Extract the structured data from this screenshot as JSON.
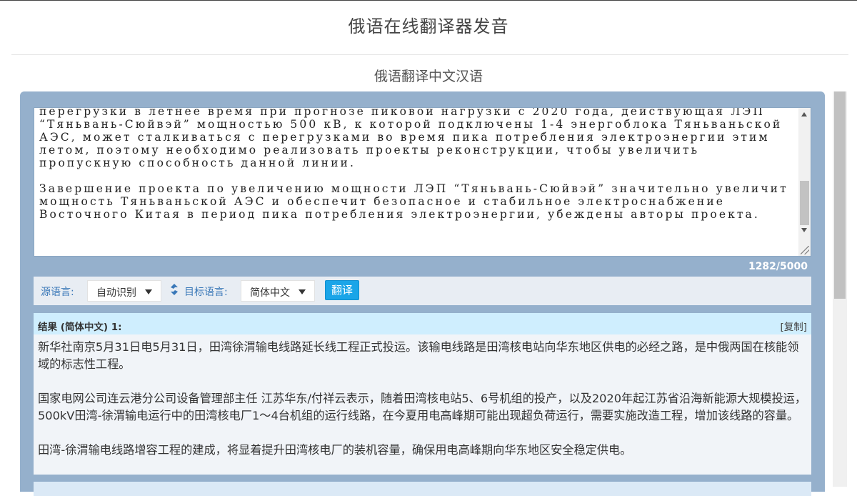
{
  "header": {
    "title": "俄语在线翻译器发音",
    "subtitle": "俄语翻译中文汉语"
  },
  "editor": {
    "source_text": "перегрузки в летнее время при прогнозе пиковой нагрузки с 2020 года, действующая ЛЭП “Тяньвань-Сюйвэй” мощностью 500 кВ, к которой подключены 1-4 энергоблока Тяньваньской АЭС, может сталкиваться с перегрузками во время пика потребления электроэнергии этим летом, поэтому необходимо реализовать проекты реконструкции, чтобы увеличить пропускную способность данной линии.\n\nЗавершение проекта по увеличению мощности ЛЭП “Тяньвань-Сюйвэй” значительно увеличит мощность Тяньваньской АЭС и обеспечит безопасное и стабильное электроснабжение Восточного Китая в период пика потребления электроэнергии, убеждены авторы проекта.",
    "char_count": "1282/5000"
  },
  "controls": {
    "source_lang_label": "源语言:",
    "source_lang_value": "自动识别",
    "target_lang_label": "目标语言:",
    "target_lang_value": "简体中文",
    "translate_label": "翻译"
  },
  "result": {
    "title": "结果 (简体中文) 1:",
    "copy_label": "[复制]",
    "paragraphs": [
      "新华社南京5月31日电5月31日，田湾徐渭输电线路延长线工程正式投运。该输电线路是田湾核电站向华东地区供电的必经之路，是中俄两国在核能领域的标志性工程。",
      "国家电网公司连云港分公司设备管理部主任 江苏华东/付祥云表示，随着田湾核电站5、6号机组的投产，以及2020年起江苏省沿海新能源大规模投运，500kV田湾-徐渭输电运行中的田湾核电厂1～4台机组的运行线路，在今夏用电高峰期可能出现超负荷运行，需要实施改造工程，增加该线路的容量。",
      "田湾-徐渭输电线路增容工程的建成，将显着提升田湾核电厂的装机容量，确保用电高峰期向华东地区安全稳定供电。"
    ]
  },
  "icons": {
    "swap": "swap-icon",
    "caret": "chevron-down-icon"
  },
  "colors": {
    "panel": "#95b0cc",
    "accent": "#1aa5e8",
    "label": "#3a78b8"
  }
}
